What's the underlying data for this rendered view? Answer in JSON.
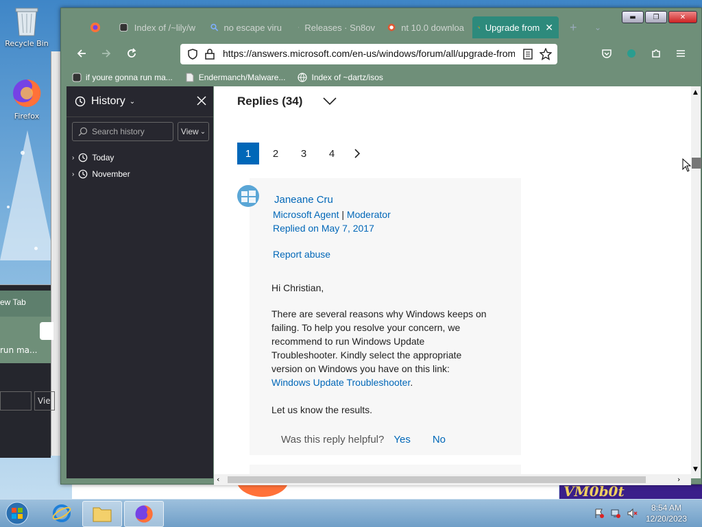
{
  "desktop": {
    "icons": [
      {
        "label": "Recycle Bin"
      },
      {
        "label": "Firefox"
      }
    ],
    "background_window": {
      "tab_label": "ew Tab",
      "bookmark_label": "run ma...",
      "view_label": "Vie"
    }
  },
  "browser": {
    "tabs": [
      {
        "title": "",
        "icon": "firefox-icon"
      },
      {
        "title": "Index of /~lily/w",
        "icon": "index-icon"
      },
      {
        "title": "no escape viru",
        "icon": "search-icon"
      },
      {
        "title": "Releases · Sn8ov",
        "icon": "github-icon"
      },
      {
        "title": "nt 10.0 downloa",
        "icon": "duckduckgo-icon"
      },
      {
        "title": "Upgrade from",
        "icon": "microsoft-icon",
        "active": true
      }
    ],
    "url": "https://answers.microsoft.com/en-us/windows/forum/all/upgrade-from",
    "bookmarks": [
      {
        "label": "if youre gonna run ma..."
      },
      {
        "label": "Endermanch/Malware..."
      },
      {
        "label": "Index of ~dartz/isos"
      }
    ]
  },
  "sidebar": {
    "title": "History",
    "search_placeholder": "Search history",
    "view_label": "View",
    "groups": [
      {
        "label": "Today"
      },
      {
        "label": "November"
      }
    ]
  },
  "content": {
    "replies_label": "Replies (34)",
    "pages": [
      "1",
      "2",
      "3",
      "4"
    ],
    "current_page": "1",
    "reply": {
      "author": "Janeane Cru",
      "role": "Microsoft Agent",
      "separator": "|",
      "role2": "Moderator",
      "date": "Replied on May 7, 2017",
      "report": "Report abuse",
      "greeting": "Hi Christian,",
      "body_lines": [
        "There are several reasons why Windows keeps on",
        "failing. To help you resolve your concern, we",
        "recommend to run Windows Update",
        "Troubleshooter. Kindly select the appropriate",
        "version on Windows you have on this link:"
      ],
      "link": "Windows Update Troubleshooter",
      "link_suffix": ".",
      "closing": "Let us know the results.",
      "helpful_q": "Was this reply helpful?",
      "yes": "Yes",
      "no": "No"
    }
  },
  "taskbar": {
    "time": "8:54 AM",
    "date": "12/20/2023",
    "background_text": "VM0b0t"
  }
}
